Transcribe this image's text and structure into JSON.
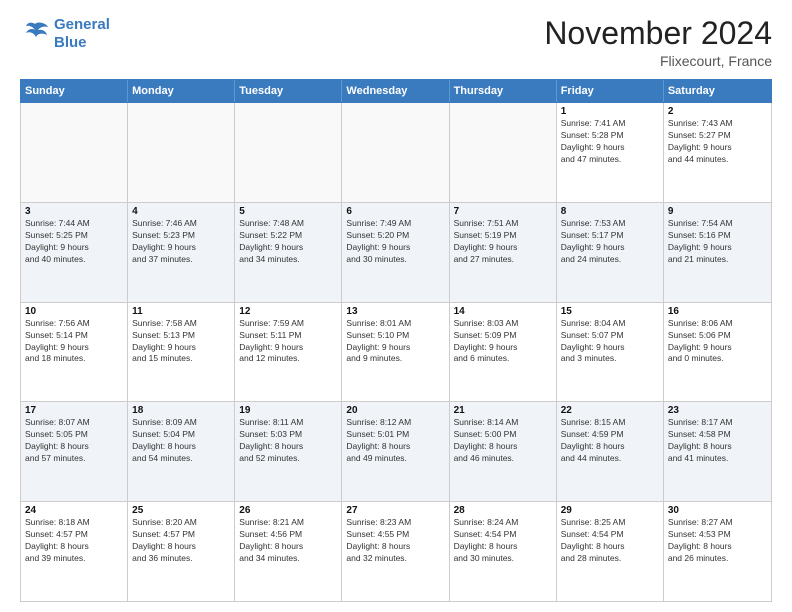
{
  "header": {
    "logo_line1": "General",
    "logo_line2": "Blue",
    "month": "November 2024",
    "location": "Flixecourt, France"
  },
  "days": [
    "Sunday",
    "Monday",
    "Tuesday",
    "Wednesday",
    "Thursday",
    "Friday",
    "Saturday"
  ],
  "rows": [
    [
      {
        "day": "",
        "text": ""
      },
      {
        "day": "",
        "text": ""
      },
      {
        "day": "",
        "text": ""
      },
      {
        "day": "",
        "text": ""
      },
      {
        "day": "",
        "text": ""
      },
      {
        "day": "1",
        "text": "Sunrise: 7:41 AM\nSunset: 5:28 PM\nDaylight: 9 hours\nand 47 minutes."
      },
      {
        "day": "2",
        "text": "Sunrise: 7:43 AM\nSunset: 5:27 PM\nDaylight: 9 hours\nand 44 minutes."
      }
    ],
    [
      {
        "day": "3",
        "text": "Sunrise: 7:44 AM\nSunset: 5:25 PM\nDaylight: 9 hours\nand 40 minutes."
      },
      {
        "day": "4",
        "text": "Sunrise: 7:46 AM\nSunset: 5:23 PM\nDaylight: 9 hours\nand 37 minutes."
      },
      {
        "day": "5",
        "text": "Sunrise: 7:48 AM\nSunset: 5:22 PM\nDaylight: 9 hours\nand 34 minutes."
      },
      {
        "day": "6",
        "text": "Sunrise: 7:49 AM\nSunset: 5:20 PM\nDaylight: 9 hours\nand 30 minutes."
      },
      {
        "day": "7",
        "text": "Sunrise: 7:51 AM\nSunset: 5:19 PM\nDaylight: 9 hours\nand 27 minutes."
      },
      {
        "day": "8",
        "text": "Sunrise: 7:53 AM\nSunset: 5:17 PM\nDaylight: 9 hours\nand 24 minutes."
      },
      {
        "day": "9",
        "text": "Sunrise: 7:54 AM\nSunset: 5:16 PM\nDaylight: 9 hours\nand 21 minutes."
      }
    ],
    [
      {
        "day": "10",
        "text": "Sunrise: 7:56 AM\nSunset: 5:14 PM\nDaylight: 9 hours\nand 18 minutes."
      },
      {
        "day": "11",
        "text": "Sunrise: 7:58 AM\nSunset: 5:13 PM\nDaylight: 9 hours\nand 15 minutes."
      },
      {
        "day": "12",
        "text": "Sunrise: 7:59 AM\nSunset: 5:11 PM\nDaylight: 9 hours\nand 12 minutes."
      },
      {
        "day": "13",
        "text": "Sunrise: 8:01 AM\nSunset: 5:10 PM\nDaylight: 9 hours\nand 9 minutes."
      },
      {
        "day": "14",
        "text": "Sunrise: 8:03 AM\nSunset: 5:09 PM\nDaylight: 9 hours\nand 6 minutes."
      },
      {
        "day": "15",
        "text": "Sunrise: 8:04 AM\nSunset: 5:07 PM\nDaylight: 9 hours\nand 3 minutes."
      },
      {
        "day": "16",
        "text": "Sunrise: 8:06 AM\nSunset: 5:06 PM\nDaylight: 9 hours\nand 0 minutes."
      }
    ],
    [
      {
        "day": "17",
        "text": "Sunrise: 8:07 AM\nSunset: 5:05 PM\nDaylight: 8 hours\nand 57 minutes."
      },
      {
        "day": "18",
        "text": "Sunrise: 8:09 AM\nSunset: 5:04 PM\nDaylight: 8 hours\nand 54 minutes."
      },
      {
        "day": "19",
        "text": "Sunrise: 8:11 AM\nSunset: 5:03 PM\nDaylight: 8 hours\nand 52 minutes."
      },
      {
        "day": "20",
        "text": "Sunrise: 8:12 AM\nSunset: 5:01 PM\nDaylight: 8 hours\nand 49 minutes."
      },
      {
        "day": "21",
        "text": "Sunrise: 8:14 AM\nSunset: 5:00 PM\nDaylight: 8 hours\nand 46 minutes."
      },
      {
        "day": "22",
        "text": "Sunrise: 8:15 AM\nSunset: 4:59 PM\nDaylight: 8 hours\nand 44 minutes."
      },
      {
        "day": "23",
        "text": "Sunrise: 8:17 AM\nSunset: 4:58 PM\nDaylight: 8 hours\nand 41 minutes."
      }
    ],
    [
      {
        "day": "24",
        "text": "Sunrise: 8:18 AM\nSunset: 4:57 PM\nDaylight: 8 hours\nand 39 minutes."
      },
      {
        "day": "25",
        "text": "Sunrise: 8:20 AM\nSunset: 4:57 PM\nDaylight: 8 hours\nand 36 minutes."
      },
      {
        "day": "26",
        "text": "Sunrise: 8:21 AM\nSunset: 4:56 PM\nDaylight: 8 hours\nand 34 minutes."
      },
      {
        "day": "27",
        "text": "Sunrise: 8:23 AM\nSunset: 4:55 PM\nDaylight: 8 hours\nand 32 minutes."
      },
      {
        "day": "28",
        "text": "Sunrise: 8:24 AM\nSunset: 4:54 PM\nDaylight: 8 hours\nand 30 minutes."
      },
      {
        "day": "29",
        "text": "Sunrise: 8:25 AM\nSunset: 4:54 PM\nDaylight: 8 hours\nand 28 minutes."
      },
      {
        "day": "30",
        "text": "Sunrise: 8:27 AM\nSunset: 4:53 PM\nDaylight: 8 hours\nand 26 minutes."
      }
    ]
  ]
}
